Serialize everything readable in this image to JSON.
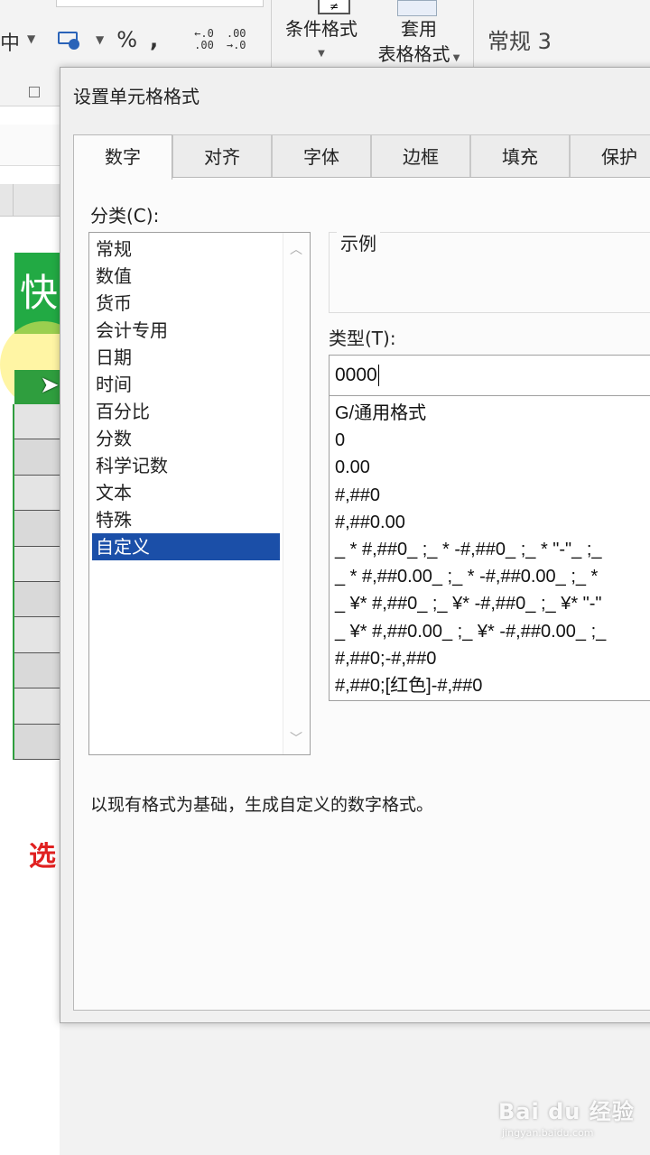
{
  "ribbon": {
    "partial_label": "中",
    "percent": "%",
    "comma": ",",
    "inc_decimal_top": "←.0",
    "inc_decimal_bottom": ".00",
    "dec_decimal_top": ".00",
    "dec_decimal_bottom": "→.0",
    "conditional_format": "条件格式",
    "table_format_line1": "套用",
    "table_format_line2": "表格格式",
    "style_preview": "常规 3"
  },
  "sheet": {
    "title_cell": "快",
    "instruction_text": "选"
  },
  "dialog": {
    "title": "设置单元格格式",
    "tabs": [
      {
        "label": "数字",
        "active": true
      },
      {
        "label": "对齐",
        "active": false
      },
      {
        "label": "字体",
        "active": false
      },
      {
        "label": "边框",
        "active": false
      },
      {
        "label": "填充",
        "active": false
      },
      {
        "label": "保护",
        "active": false
      }
    ],
    "category_label": "分类(C):",
    "categories": [
      {
        "label": "常规",
        "selected": false
      },
      {
        "label": "数值",
        "selected": false
      },
      {
        "label": "货币",
        "selected": false
      },
      {
        "label": "会计专用",
        "selected": false
      },
      {
        "label": "日期",
        "selected": false
      },
      {
        "label": "时间",
        "selected": false
      },
      {
        "label": "百分比",
        "selected": false
      },
      {
        "label": "分数",
        "selected": false
      },
      {
        "label": "科学记数",
        "selected": false
      },
      {
        "label": "文本",
        "selected": false
      },
      {
        "label": "特殊",
        "selected": false
      },
      {
        "label": "自定义",
        "selected": true
      }
    ],
    "sample_label": "示例",
    "type_label": "类型(T):",
    "type_value": "0000",
    "formats": [
      "G/通用格式",
      "0",
      "0.00",
      "#,##0",
      "#,##0.00",
      "_ * #,##0_ ;_ * -#,##0_ ;_ * \"-\"_ ;_",
      "_ * #,##0.00_ ;_ * -#,##0.00_ ;_ *",
      "_ ¥* #,##0_ ;_ ¥* -#,##0_ ;_ ¥* \"-\"",
      "_ ¥* #,##0.00_ ;_ ¥* -#,##0.00_ ;_",
      "#,##0;-#,##0",
      "#,##0;[红色]-#,##0"
    ],
    "description": "以现有格式为基础，生成自定义的数字格式。"
  },
  "watermark": {
    "main": "Bai du 经验",
    "sub": "jingyan.baidu.com"
  },
  "colors": {
    "selection": "#1b4fa8",
    "sheet_green": "#22aa44",
    "instruction_red": "#e02020"
  }
}
